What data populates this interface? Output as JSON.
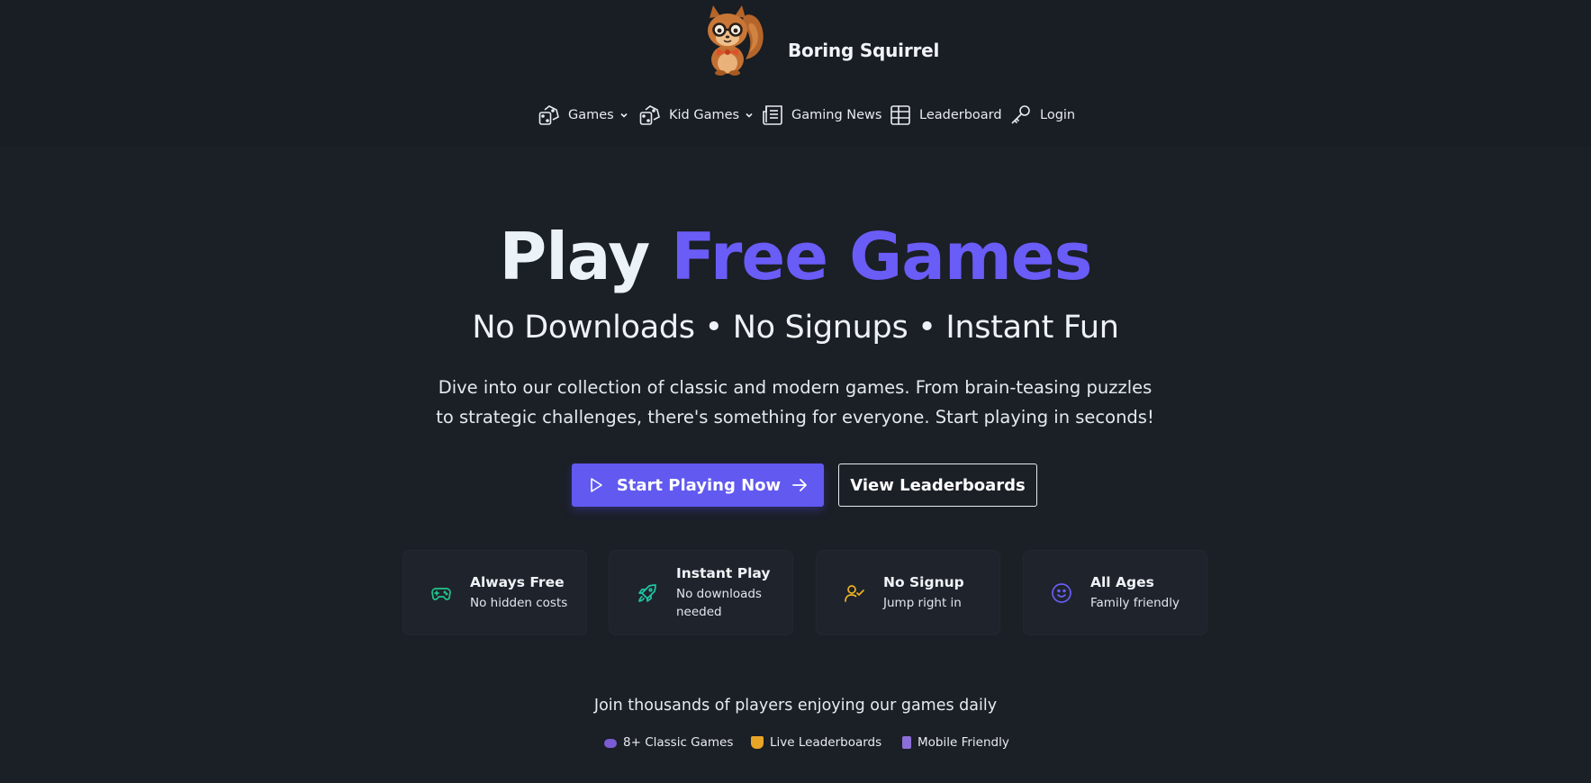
{
  "brand": {
    "name": "Boring Squirrel"
  },
  "nav": {
    "items": [
      {
        "label": "Games",
        "icon": "dice-icon",
        "dropdown": true
      },
      {
        "label": "Kid Games",
        "icon": "dice-icon",
        "dropdown": true
      },
      {
        "label": "Gaming News",
        "icon": "newspaper-icon",
        "dropdown": false
      },
      {
        "label": "Leaderboard",
        "icon": "table-icon",
        "dropdown": false
      },
      {
        "label": "Login",
        "icon": "key-icon",
        "dropdown": false
      }
    ]
  },
  "hero": {
    "title_white": "Play",
    "title_accent": "Free Games",
    "subtitle": "No Downloads • No Signups • Instant Fun",
    "description": "Dive into our collection of classic and modern games. From brain-teasing puzzles to strategic challenges, there's something for everyone. Start playing in seconds!",
    "primary_button": "Start Playing Now",
    "secondary_button": "View Leaderboards"
  },
  "features": [
    {
      "title": "Always Free",
      "subtitle": "No hidden costs",
      "icon": "gamepad-icon",
      "color": "#22c58b"
    },
    {
      "title": "Instant Play",
      "subtitle": "No downloads needed",
      "icon": "rocket-icon",
      "color": "#1fc7a6"
    },
    {
      "title": "No Signup",
      "subtitle": "Jump right in",
      "icon": "user-check-icon",
      "color": "#f0b323"
    },
    {
      "title": "All Ages",
      "subtitle": "Family friendly",
      "icon": "smile-icon",
      "color": "#6a5cf6"
    }
  ],
  "footer": {
    "join_text": "Join thousands of players enjoying our games daily",
    "highlights": [
      {
        "label": "8+ Classic Games",
        "icon": "game-controller-emoji",
        "color": "#7b5cd6"
      },
      {
        "label": "Live Leaderboards",
        "icon": "trophy-emoji",
        "color": "#e8a526"
      },
      {
        "label": "Mobile Friendly",
        "icon": "mobile-phone-emoji",
        "color": "#8d6fd9"
      }
    ]
  },
  "colors": {
    "accent": "#6159f0",
    "background": "#1b1f26"
  }
}
